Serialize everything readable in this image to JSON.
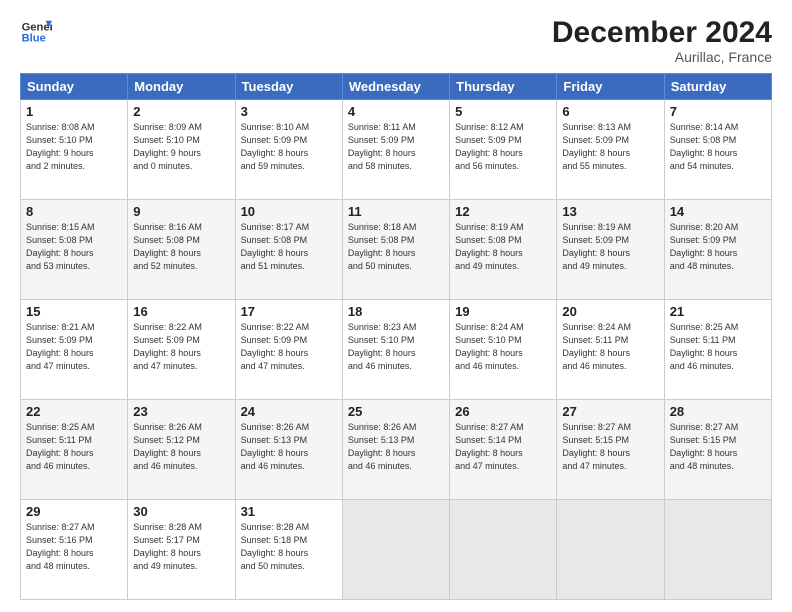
{
  "header": {
    "logo_line1": "General",
    "logo_line2": "Blue",
    "month": "December 2024",
    "location": "Aurillac, France"
  },
  "days_of_week": [
    "Sunday",
    "Monday",
    "Tuesday",
    "Wednesday",
    "Thursday",
    "Friday",
    "Saturday"
  ],
  "weeks": [
    [
      {
        "day": 1,
        "info": "Sunrise: 8:08 AM\nSunset: 5:10 PM\nDaylight: 9 hours\nand 2 minutes."
      },
      {
        "day": 2,
        "info": "Sunrise: 8:09 AM\nSunset: 5:10 PM\nDaylight: 9 hours\nand 0 minutes."
      },
      {
        "day": 3,
        "info": "Sunrise: 8:10 AM\nSunset: 5:09 PM\nDaylight: 8 hours\nand 59 minutes."
      },
      {
        "day": 4,
        "info": "Sunrise: 8:11 AM\nSunset: 5:09 PM\nDaylight: 8 hours\nand 58 minutes."
      },
      {
        "day": 5,
        "info": "Sunrise: 8:12 AM\nSunset: 5:09 PM\nDaylight: 8 hours\nand 56 minutes."
      },
      {
        "day": 6,
        "info": "Sunrise: 8:13 AM\nSunset: 5:09 PM\nDaylight: 8 hours\nand 55 minutes."
      },
      {
        "day": 7,
        "info": "Sunrise: 8:14 AM\nSunset: 5:08 PM\nDaylight: 8 hours\nand 54 minutes."
      }
    ],
    [
      {
        "day": 8,
        "info": "Sunrise: 8:15 AM\nSunset: 5:08 PM\nDaylight: 8 hours\nand 53 minutes."
      },
      {
        "day": 9,
        "info": "Sunrise: 8:16 AM\nSunset: 5:08 PM\nDaylight: 8 hours\nand 52 minutes."
      },
      {
        "day": 10,
        "info": "Sunrise: 8:17 AM\nSunset: 5:08 PM\nDaylight: 8 hours\nand 51 minutes."
      },
      {
        "day": 11,
        "info": "Sunrise: 8:18 AM\nSunset: 5:08 PM\nDaylight: 8 hours\nand 50 minutes."
      },
      {
        "day": 12,
        "info": "Sunrise: 8:19 AM\nSunset: 5:08 PM\nDaylight: 8 hours\nand 49 minutes."
      },
      {
        "day": 13,
        "info": "Sunrise: 8:19 AM\nSunset: 5:09 PM\nDaylight: 8 hours\nand 49 minutes."
      },
      {
        "day": 14,
        "info": "Sunrise: 8:20 AM\nSunset: 5:09 PM\nDaylight: 8 hours\nand 48 minutes."
      }
    ],
    [
      {
        "day": 15,
        "info": "Sunrise: 8:21 AM\nSunset: 5:09 PM\nDaylight: 8 hours\nand 47 minutes."
      },
      {
        "day": 16,
        "info": "Sunrise: 8:22 AM\nSunset: 5:09 PM\nDaylight: 8 hours\nand 47 minutes."
      },
      {
        "day": 17,
        "info": "Sunrise: 8:22 AM\nSunset: 5:09 PM\nDaylight: 8 hours\nand 47 minutes."
      },
      {
        "day": 18,
        "info": "Sunrise: 8:23 AM\nSunset: 5:10 PM\nDaylight: 8 hours\nand 46 minutes."
      },
      {
        "day": 19,
        "info": "Sunrise: 8:24 AM\nSunset: 5:10 PM\nDaylight: 8 hours\nand 46 minutes."
      },
      {
        "day": 20,
        "info": "Sunrise: 8:24 AM\nSunset: 5:11 PM\nDaylight: 8 hours\nand 46 minutes."
      },
      {
        "day": 21,
        "info": "Sunrise: 8:25 AM\nSunset: 5:11 PM\nDaylight: 8 hours\nand 46 minutes."
      }
    ],
    [
      {
        "day": 22,
        "info": "Sunrise: 8:25 AM\nSunset: 5:11 PM\nDaylight: 8 hours\nand 46 minutes."
      },
      {
        "day": 23,
        "info": "Sunrise: 8:26 AM\nSunset: 5:12 PM\nDaylight: 8 hours\nand 46 minutes."
      },
      {
        "day": 24,
        "info": "Sunrise: 8:26 AM\nSunset: 5:13 PM\nDaylight: 8 hours\nand 46 minutes."
      },
      {
        "day": 25,
        "info": "Sunrise: 8:26 AM\nSunset: 5:13 PM\nDaylight: 8 hours\nand 46 minutes."
      },
      {
        "day": 26,
        "info": "Sunrise: 8:27 AM\nSunset: 5:14 PM\nDaylight: 8 hours\nand 47 minutes."
      },
      {
        "day": 27,
        "info": "Sunrise: 8:27 AM\nSunset: 5:15 PM\nDaylight: 8 hours\nand 47 minutes."
      },
      {
        "day": 28,
        "info": "Sunrise: 8:27 AM\nSunset: 5:15 PM\nDaylight: 8 hours\nand 48 minutes."
      }
    ],
    [
      {
        "day": 29,
        "info": "Sunrise: 8:27 AM\nSunset: 5:16 PM\nDaylight: 8 hours\nand 48 minutes."
      },
      {
        "day": 30,
        "info": "Sunrise: 8:28 AM\nSunset: 5:17 PM\nDaylight: 8 hours\nand 49 minutes."
      },
      {
        "day": 31,
        "info": "Sunrise: 8:28 AM\nSunset: 5:18 PM\nDaylight: 8 hours\nand 50 minutes."
      },
      null,
      null,
      null,
      null
    ]
  ]
}
